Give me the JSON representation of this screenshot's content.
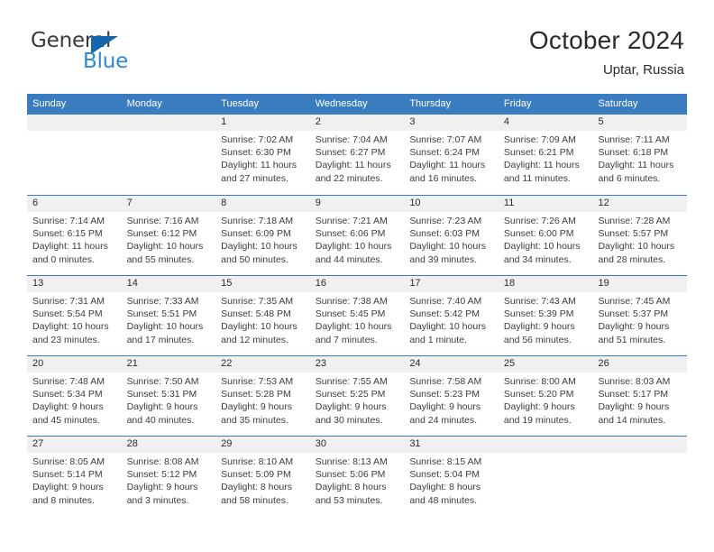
{
  "brand": {
    "word_one": "General",
    "word_two": "Blue",
    "triangle_color": "#1666ad",
    "blue_text_color": "#2e8ad6"
  },
  "header": {
    "month_title": "October 2024",
    "location": "Uptar, Russia"
  },
  "theme": {
    "header_blue": "#3a7cc0",
    "date_strip_gray": "#f0f0f0",
    "text_color": "#2b2b2b"
  },
  "calendar": {
    "weekdays": [
      "Sunday",
      "Monday",
      "Tuesday",
      "Wednesday",
      "Thursday",
      "Friday",
      "Saturday"
    ],
    "weeks": [
      [
        {
          "day": "",
          "empty": true
        },
        {
          "day": "",
          "empty": true
        },
        {
          "day": "1",
          "sunrise": "Sunrise: 7:02 AM",
          "sunset": "Sunset: 6:30 PM",
          "daylight": "Daylight: 11 hours and 27 minutes."
        },
        {
          "day": "2",
          "sunrise": "Sunrise: 7:04 AM",
          "sunset": "Sunset: 6:27 PM",
          "daylight": "Daylight: 11 hours and 22 minutes."
        },
        {
          "day": "3",
          "sunrise": "Sunrise: 7:07 AM",
          "sunset": "Sunset: 6:24 PM",
          "daylight": "Daylight: 11 hours and 16 minutes."
        },
        {
          "day": "4",
          "sunrise": "Sunrise: 7:09 AM",
          "sunset": "Sunset: 6:21 PM",
          "daylight": "Daylight: 11 hours and 11 minutes."
        },
        {
          "day": "5",
          "sunrise": "Sunrise: 7:11 AM",
          "sunset": "Sunset: 6:18 PM",
          "daylight": "Daylight: 11 hours and 6 minutes."
        }
      ],
      [
        {
          "day": "6",
          "sunrise": "Sunrise: 7:14 AM",
          "sunset": "Sunset: 6:15 PM",
          "daylight": "Daylight: 11 hours and 0 minutes."
        },
        {
          "day": "7",
          "sunrise": "Sunrise: 7:16 AM",
          "sunset": "Sunset: 6:12 PM",
          "daylight": "Daylight: 10 hours and 55 minutes."
        },
        {
          "day": "8",
          "sunrise": "Sunrise: 7:18 AM",
          "sunset": "Sunset: 6:09 PM",
          "daylight": "Daylight: 10 hours and 50 minutes."
        },
        {
          "day": "9",
          "sunrise": "Sunrise: 7:21 AM",
          "sunset": "Sunset: 6:06 PM",
          "daylight": "Daylight: 10 hours and 44 minutes."
        },
        {
          "day": "10",
          "sunrise": "Sunrise: 7:23 AM",
          "sunset": "Sunset: 6:03 PM",
          "daylight": "Daylight: 10 hours and 39 minutes."
        },
        {
          "day": "11",
          "sunrise": "Sunrise: 7:26 AM",
          "sunset": "Sunset: 6:00 PM",
          "daylight": "Daylight: 10 hours and 34 minutes."
        },
        {
          "day": "12",
          "sunrise": "Sunrise: 7:28 AM",
          "sunset": "Sunset: 5:57 PM",
          "daylight": "Daylight: 10 hours and 28 minutes."
        }
      ],
      [
        {
          "day": "13",
          "sunrise": "Sunrise: 7:31 AM",
          "sunset": "Sunset: 5:54 PM",
          "daylight": "Daylight: 10 hours and 23 minutes."
        },
        {
          "day": "14",
          "sunrise": "Sunrise: 7:33 AM",
          "sunset": "Sunset: 5:51 PM",
          "daylight": "Daylight: 10 hours and 17 minutes."
        },
        {
          "day": "15",
          "sunrise": "Sunrise: 7:35 AM",
          "sunset": "Sunset: 5:48 PM",
          "daylight": "Daylight: 10 hours and 12 minutes."
        },
        {
          "day": "16",
          "sunrise": "Sunrise: 7:38 AM",
          "sunset": "Sunset: 5:45 PM",
          "daylight": "Daylight: 10 hours and 7 minutes."
        },
        {
          "day": "17",
          "sunrise": "Sunrise: 7:40 AM",
          "sunset": "Sunset: 5:42 PM",
          "daylight": "Daylight: 10 hours and 1 minute."
        },
        {
          "day": "18",
          "sunrise": "Sunrise: 7:43 AM",
          "sunset": "Sunset: 5:39 PM",
          "daylight": "Daylight: 9 hours and 56 minutes."
        },
        {
          "day": "19",
          "sunrise": "Sunrise: 7:45 AM",
          "sunset": "Sunset: 5:37 PM",
          "daylight": "Daylight: 9 hours and 51 minutes."
        }
      ],
      [
        {
          "day": "20",
          "sunrise": "Sunrise: 7:48 AM",
          "sunset": "Sunset: 5:34 PM",
          "daylight": "Daylight: 9 hours and 45 minutes."
        },
        {
          "day": "21",
          "sunrise": "Sunrise: 7:50 AM",
          "sunset": "Sunset: 5:31 PM",
          "daylight": "Daylight: 9 hours and 40 minutes."
        },
        {
          "day": "22",
          "sunrise": "Sunrise: 7:53 AM",
          "sunset": "Sunset: 5:28 PM",
          "daylight": "Daylight: 9 hours and 35 minutes."
        },
        {
          "day": "23",
          "sunrise": "Sunrise: 7:55 AM",
          "sunset": "Sunset: 5:25 PM",
          "daylight": "Daylight: 9 hours and 30 minutes."
        },
        {
          "day": "24",
          "sunrise": "Sunrise: 7:58 AM",
          "sunset": "Sunset: 5:23 PM",
          "daylight": "Daylight: 9 hours and 24 minutes."
        },
        {
          "day": "25",
          "sunrise": "Sunrise: 8:00 AM",
          "sunset": "Sunset: 5:20 PM",
          "daylight": "Daylight: 9 hours and 19 minutes."
        },
        {
          "day": "26",
          "sunrise": "Sunrise: 8:03 AM",
          "sunset": "Sunset: 5:17 PM",
          "daylight": "Daylight: 9 hours and 14 minutes."
        }
      ],
      [
        {
          "day": "27",
          "sunrise": "Sunrise: 8:05 AM",
          "sunset": "Sunset: 5:14 PM",
          "daylight": "Daylight: 9 hours and 8 minutes."
        },
        {
          "day": "28",
          "sunrise": "Sunrise: 8:08 AM",
          "sunset": "Sunset: 5:12 PM",
          "daylight": "Daylight: 9 hours and 3 minutes."
        },
        {
          "day": "29",
          "sunrise": "Sunrise: 8:10 AM",
          "sunset": "Sunset: 5:09 PM",
          "daylight": "Daylight: 8 hours and 58 minutes."
        },
        {
          "day": "30",
          "sunrise": "Sunrise: 8:13 AM",
          "sunset": "Sunset: 5:06 PM",
          "daylight": "Daylight: 8 hours and 53 minutes."
        },
        {
          "day": "31",
          "sunrise": "Sunrise: 8:15 AM",
          "sunset": "Sunset: 5:04 PM",
          "daylight": "Daylight: 8 hours and 48 minutes."
        },
        {
          "day": "",
          "empty": true
        },
        {
          "day": "",
          "empty": true
        }
      ]
    ]
  }
}
